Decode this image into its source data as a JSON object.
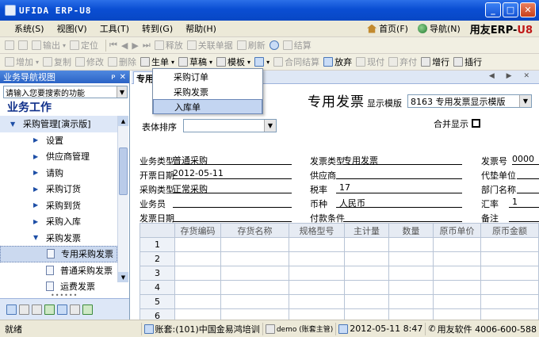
{
  "window": {
    "title": "UFIDA ERP-U8",
    "controls": [
      "_",
      "□",
      "✕"
    ]
  },
  "menu": {
    "items": [
      "系统(S)",
      "视图(V)",
      "工具(T)",
      "转到(G)",
      "帮助(H)"
    ],
    "right": {
      "home": "首页(F)",
      "nav": "导航(N)",
      "brand_main": "用友ERP-",
      "brand_accent": "U8"
    }
  },
  "toolbar1": {
    "items": [
      "输出",
      "定位",
      "释放",
      "关联单据",
      "刷新",
      "结算"
    ]
  },
  "toolbar2": {
    "items": [
      "增加",
      "复制",
      "修改",
      "删除",
      "生单",
      "草稿",
      "模板",
      "合同结算",
      "放弃",
      "现付",
      "弃付",
      "增行",
      "插行"
    ]
  },
  "sidebar": {
    "header": "业务导航视图",
    "header_buttons": [
      "ᴘ",
      "✕"
    ],
    "search_placeholder": "请输入您要搜索的功能",
    "section_title": "业务工作",
    "tree": [
      {
        "label": "采购管理[演示版]",
        "level": 1,
        "arrow": "▼"
      },
      {
        "label": "设置",
        "level": 2,
        "arrow": "▶"
      },
      {
        "label": "供应商管理",
        "level": 2,
        "arrow": "▶"
      },
      {
        "label": "请购",
        "level": 2,
        "arrow": "▶"
      },
      {
        "label": "采购订货",
        "level": 2,
        "arrow": "▶"
      },
      {
        "label": "采购到货",
        "level": 2,
        "arrow": "▶"
      },
      {
        "label": "采购入库",
        "level": 2,
        "arrow": "▶"
      },
      {
        "label": "采购发票",
        "level": 2,
        "arrow": "▼"
      },
      {
        "label": "专用采购发票",
        "level": 3,
        "selected": true
      },
      {
        "label": "普通采购发票",
        "level": 3
      },
      {
        "label": "运费发票",
        "level": 3
      }
    ]
  },
  "document": {
    "tab_label": "专用",
    "tab_nav": "◀ ▶ ✕",
    "title": "专用发票",
    "template_label": "显示模版",
    "template_value": "8163 专用发票显示模版",
    "sort_label": "表体排序",
    "sort_value": "",
    "merge_label": "合并显示",
    "fields": {
      "biz_type_label": "业务类型",
      "biz_type": "普通采购",
      "inv_type_label": "发票类型",
      "inv_type": "专用发票",
      "inv_no_label": "发票号",
      "inv_no": "0000",
      "open_date_label": "开票日期",
      "open_date": "2012-05-11",
      "supplier_label": "供应商",
      "supplier": "",
      "agent_label": "代垫单位",
      "agent": "",
      "purchase_type_label": "采购类型",
      "purchase_type": "正常采购",
      "tax_rate_label": "税率",
      "tax_rate": "17",
      "dept_label": "部门名称",
      "dept": "",
      "buyer_label": "业务员",
      "buyer": "",
      "currency_label": "币种",
      "currency": "人民币",
      "fx_label": "汇率",
      "fx": "1",
      "inv_date_label": "发票日期",
      "inv_date": "",
      "pay_terms_label": "付款条件",
      "pay_terms": "",
      "remark_label": "备注",
      "remark": ""
    },
    "grid": {
      "columns": [
        "",
        "存货编码",
        "存货名称",
        "规格型号",
        "主计量",
        "数量",
        "原币单价",
        "原币金额"
      ],
      "rows": [
        "1",
        "2",
        "3",
        "4",
        "5",
        "6"
      ]
    }
  },
  "dropdown_menu": {
    "items": [
      "采购订单",
      "采购发票",
      "入库单"
    ],
    "highlighted": 2
  },
  "statusbar": {
    "ready": "就绪",
    "account": "账套:(101)中国金易鸿培训",
    "user": "demo (账套主管)",
    "date_time": "2012-05-11  8:47",
    "vendor": "用友软件 4006-600-588"
  }
}
